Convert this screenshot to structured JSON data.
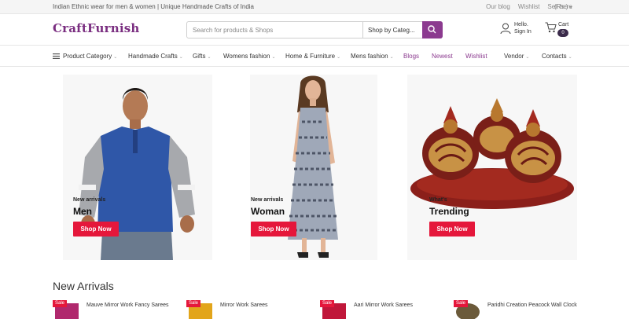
{
  "topbar": {
    "tagline": "Indian Ethnic wear for men & women | Unique Handmade Crafts of India",
    "links": [
      "Our blog",
      "Wishlist",
      "Sell here"
    ],
    "currency": "(Rs.)"
  },
  "header": {
    "logo": "CraftFurnish",
    "search_placeholder": "Search for products & Shops",
    "category_select": "Shop by Categ...",
    "user_hello": "Hello.",
    "user_signin": "Sign In",
    "cart_label": "Cart",
    "cart_count": "0"
  },
  "nav": {
    "items": [
      {
        "label": "Product Category"
      },
      {
        "label": "Handmade Crafts"
      },
      {
        "label": "Gifts"
      },
      {
        "label": "Womens fashion"
      },
      {
        "label": "Home & Furniture"
      },
      {
        "label": "Mens fashion"
      },
      {
        "label": "Blogs"
      },
      {
        "label": "Newest"
      },
      {
        "label": "Wishlist"
      },
      {
        "label": "Vendor"
      },
      {
        "label": "Contacts"
      }
    ]
  },
  "hero": [
    {
      "small": "New arrivals",
      "big": "Men",
      "button": "Shop Now"
    },
    {
      "small": "New arrivals",
      "big": "Woman",
      "button": "Shop Now"
    },
    {
      "small": "What's",
      "big": "Trending",
      "button": "Shop Now"
    }
  ],
  "new_arrivals": {
    "title": "New Arrivals",
    "sale_label": "Sale",
    "products": [
      {
        "name": "Mauve Mirror Work Fancy Sarees",
        "thumb_color": "#b0286d"
      },
      {
        "name": "Mirror Work Sarees",
        "thumb_color": "#e2a51b"
      },
      {
        "name": "Aari Mirror Work Sarees",
        "thumb_color": "#c0173a"
      },
      {
        "name": "Paridhi Creation Peacock Wall Clock",
        "thumb_color": "#6b5a3a"
      }
    ]
  },
  "colors": {
    "brand": "#7a2e80",
    "accent": "#8b3a8f",
    "button_red": "#e5173b"
  }
}
